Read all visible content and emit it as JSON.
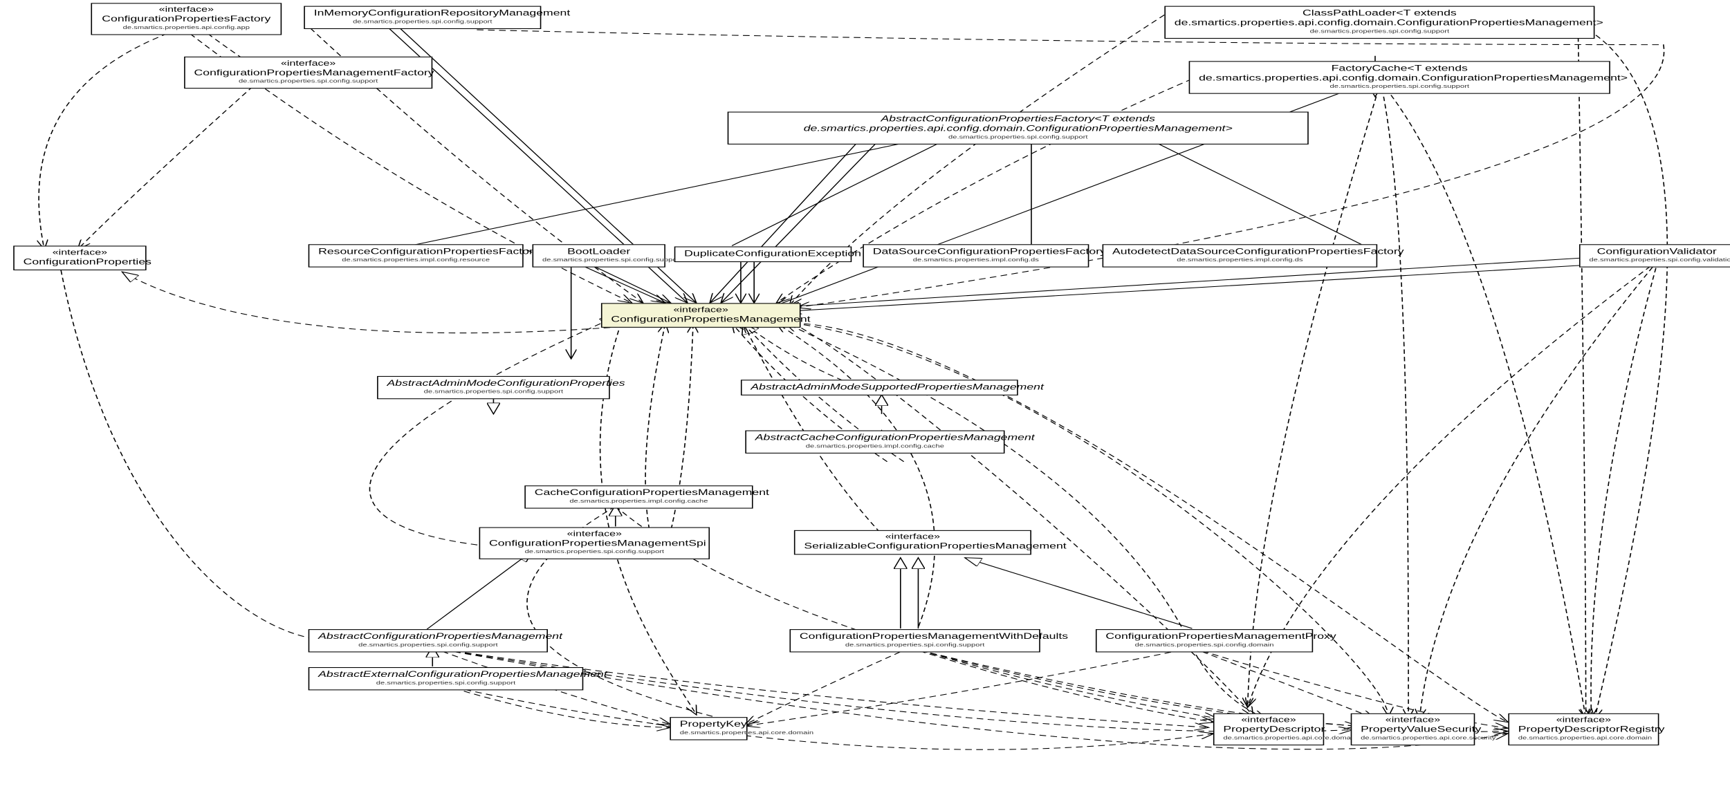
{
  "stereotypes": {
    "interface": "«interface»"
  },
  "packages": {
    "apiconfigapp": "de.smartics.properties.api.config.app",
    "spisupport": "de.smartics.properties.spi.config.support",
    "implresource": "de.smartics.properties.impl.config.resource",
    "implds": "de.smartics.properties.impl.config.ds",
    "spivalidation": "de.smartics.properties.spi.config.validation",
    "implcache": "de.smartics.properties.impl.config.cache",
    "spidomain": "de.smartics.properties.spi.config.domain",
    "apicoredomain": "de.smartics.properties.api.core.domain",
    "apicoresecurity": "de.smartics.properties.api.core.security"
  },
  "nodes": {
    "configPropertiesFactory": {
      "name": "ConfigurationPropertiesFactory"
    },
    "inMemoryConfigRepoMgmt": {
      "name": "InMemoryConfigurationRepositoryManagement"
    },
    "classPathLoader": {
      "name": "ClassPathLoader<T extends de.smartics.properties.api.config.domain.ConfigurationPropertiesManagement>"
    },
    "configPropertiesMgmtFactory": {
      "name": "ConfigurationPropertiesManagementFactory"
    },
    "factoryCache": {
      "name": "FactoryCache<T extends de.smartics.properties.api.config.domain.ConfigurationPropertiesManagement>"
    },
    "abstractConfigPropertiesFactory": {
      "name": "AbstractConfigurationPropertiesFactory<T extends de.smartics.properties.api.config.domain.ConfigurationPropertiesManagement>"
    },
    "configurationProperties": {
      "name": "ConfigurationProperties"
    },
    "resourceConfigPropertiesFactory": {
      "name": "ResourceConfigurationPropertiesFactory"
    },
    "bootLoader": {
      "name": "BootLoader"
    },
    "duplicateConfigException": {
      "name": "DuplicateConfigurationException"
    },
    "dataSourceConfigPropertiesFactory": {
      "name": "DataSourceConfigurationPropertiesFactory"
    },
    "autodetectDSConfigPropertiesFactory": {
      "name": "AutodetectDataSourceConfigurationPropertiesFactory"
    },
    "configurationValidator": {
      "name": "ConfigurationValidator"
    },
    "configPropertiesMgmt": {
      "name": "ConfigurationPropertiesManagement"
    },
    "abstractAdminModeConfigProperties": {
      "name": "AbstractAdminModeConfigurationProperties"
    },
    "abstractAdminModeSupportedPropsMgmt": {
      "name": "AbstractAdminModeSupportedPropertiesManagement"
    },
    "abstractCacheConfigPropertiesMgmt": {
      "name": "AbstractCacheConfigurationPropertiesManagement"
    },
    "cacheConfigPropertiesMgmt": {
      "name": "CacheConfigurationPropertiesManagement"
    },
    "configPropertiesMgmtSpi": {
      "name": "ConfigurationPropertiesManagementSpi"
    },
    "serializableConfigPropsMgmt": {
      "name": "SerializableConfigurationPropertiesManagement"
    },
    "abstractConfigPropertiesMgmt": {
      "name": "AbstractConfigurationPropertiesManagement"
    },
    "configPropertiesMgmtWithDefaults": {
      "name": "ConfigurationPropertiesManagementWithDefaults"
    },
    "configPropertiesMgmtProxy": {
      "name": "ConfigurationPropertiesManagementProxy"
    },
    "abstractExternalConfigPropsMgmt": {
      "name": "AbstractExternalConfigurationPropertiesManagement"
    },
    "propertyKey": {
      "name": "PropertyKey"
    },
    "propertyDescriptor": {
      "name": "PropertyDescriptor"
    },
    "propertyValueSecurity": {
      "name": "PropertyValueSecurity"
    },
    "propertyDescriptorRegistry": {
      "name": "PropertyDescriptorRegistry"
    }
  }
}
